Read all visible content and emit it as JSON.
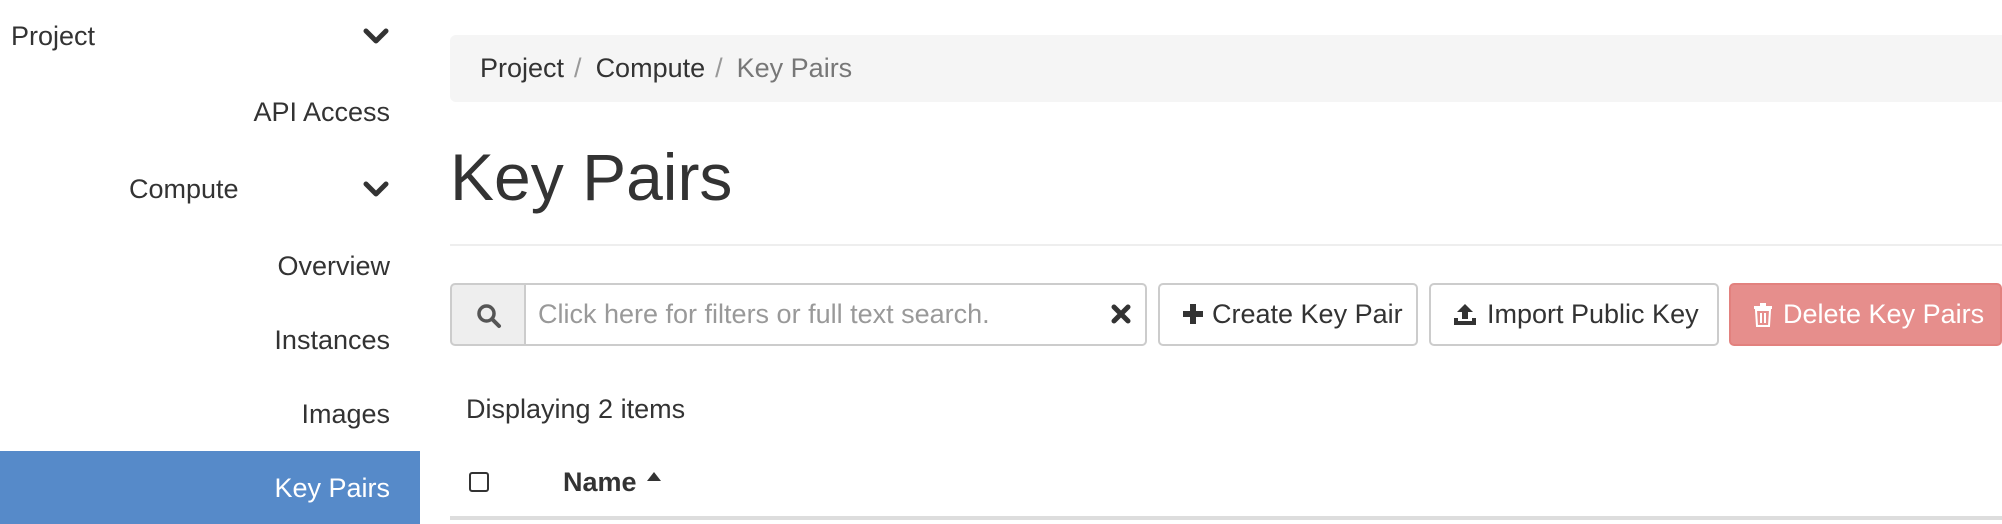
{
  "sidebar": {
    "project_label": "Project",
    "api_access_label": "API Access",
    "compute_label": "Compute",
    "items": [
      {
        "label": "Overview"
      },
      {
        "label": "Instances"
      },
      {
        "label": "Images"
      },
      {
        "label": "Key Pairs"
      }
    ],
    "active_item": "Key Pairs",
    "active_color": "#568ac9"
  },
  "breadcrumb": {
    "items": [
      "Project",
      "Compute",
      "Key Pairs"
    ],
    "separator": "/"
  },
  "page": {
    "title": "Key Pairs"
  },
  "toolbar": {
    "search_placeholder": "Click here for filters or full text search.",
    "search_value": "",
    "search_icon": "search-icon",
    "clear_icon": "times-icon",
    "create_label": "Create Key Pair",
    "create_icon": "plus-icon",
    "import_label": "Import Public Key",
    "import_icon": "upload-icon",
    "delete_label": "Delete Key Pairs",
    "delete_icon": "trash-icon",
    "delete_color": "#d9534f"
  },
  "table": {
    "count_text": "Displaying 2 items",
    "columns": [
      {
        "label": "Name",
        "sort": "ascending"
      }
    ]
  }
}
